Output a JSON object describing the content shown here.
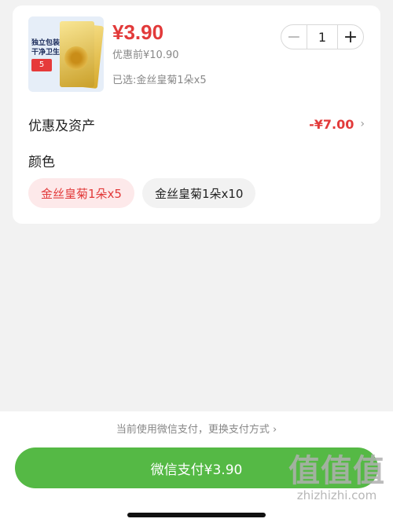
{
  "product": {
    "image_tag_text": "独立包装干净卫生",
    "image_badge": "5",
    "price": "¥3.90",
    "original_price": "优惠前¥10.90",
    "selected": "已选:金丝皇菊1朵x5",
    "quantity": "1"
  },
  "discount": {
    "label": "优惠及资产",
    "value": "-¥7.00"
  },
  "color": {
    "label": "颜色",
    "options": [
      {
        "label": "金丝皇菊1朵x5",
        "selected": true
      },
      {
        "label": "金丝皇菊1朵x10",
        "selected": false
      }
    ]
  },
  "payment": {
    "hint": "当前使用微信支付，更换支付方式 ›",
    "button_label": "微信支付¥3.90"
  },
  "watermark": {
    "main": "值值值",
    "site": "zhizhizhi.com"
  },
  "colors": {
    "accent_red": "#e23a3a",
    "pay_green": "#55b945",
    "selected_chip_bg": "#fde9ea"
  }
}
